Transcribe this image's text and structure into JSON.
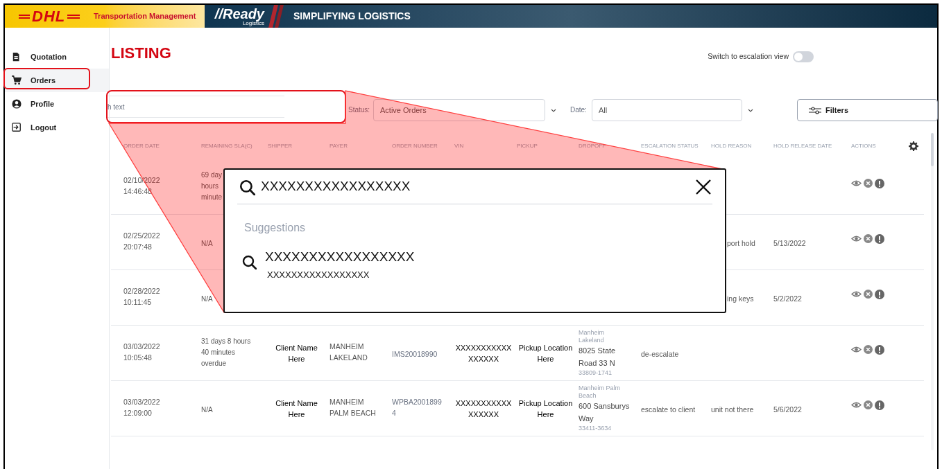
{
  "header": {
    "brand": "DHL",
    "product": "Transportation Management",
    "partner": "//Ready",
    "partner_sub": "Logistics",
    "tagline": "SIMPLIFYING LOGISTICS"
  },
  "sidebar": {
    "items": [
      {
        "kind": "document",
        "label": "Quotation",
        "selected": false,
        "highlighted": false
      },
      {
        "kind": "cart",
        "label": "Orders",
        "selected": true,
        "highlighted": true
      },
      {
        "kind": "account",
        "label": "Profile",
        "selected": false,
        "highlighted": false
      },
      {
        "kind": "logout",
        "label": "Logout",
        "selected": false,
        "highlighted": false
      }
    ]
  },
  "page_title": "LISTING",
  "escalation_toggle": {
    "label": "Switch to escalation view",
    "on": false
  },
  "search": {
    "placeholder": "h text",
    "highlighted": true
  },
  "status_filter": {
    "label": "Status:",
    "value": "Active Orders"
  },
  "date_filter": {
    "label": "Date:",
    "value": "All"
  },
  "filters_button": {
    "label": "Filters"
  },
  "table": {
    "columns": [
      "ORDER DATE",
      "REMAINING SLA(C)",
      "SHIPPER",
      "PAYER",
      "ORDER NUMBER",
      "VIN",
      "PICKUP",
      "DROPOFF",
      "ESCALATION STATUS",
      "HOLD REASON",
      "HOLD RELEASE DATE",
      "ACTIONS"
    ],
    "rows": [
      {
        "order_date": "02/10/2022\n14:46:48",
        "remaining_sla": "69 day\nhours\nminute"
      },
      {
        "order_date": "02/25/2022\n20:07:48",
        "remaining_sla": "N/A",
        "hold_reason": "port hold",
        "hold_release_date": "5/13/2022"
      },
      {
        "order_date": "02/28/2022\n10:11:45",
        "remaining_sla": "N/A",
        "hold_reason": "ing keys",
        "hold_release_date": "5/2/2022"
      },
      {
        "order_date": "03/03/2022\n10:05:48",
        "remaining_sla": "31 days 8 hours\n40 minutes\noverdue",
        "shipper": "Client Name\nHere",
        "payer": "MANHEIM\nLAKELAND",
        "order_number": "IMS20018990",
        "vin": "XXXXXXXXXXX\nXXXXXX",
        "pickup": "Pickup Location\nHere",
        "dropoff": {
          "name": "Manheim\nLakeland",
          "address": "8025 State\nRoad 33 N",
          "zip": "33809-1741"
        },
        "escalation_status": "de-escalate"
      },
      {
        "order_date": "03/03/2022\n12:09:00",
        "remaining_sla": "N/A",
        "shipper": "Client Name\nHere",
        "payer": "MANHEIM\nPALM BEACH",
        "order_number": "WPBA2001899\n4",
        "vin": "XXXXXXXXXXX\nXXXXXX",
        "pickup": "Pickup Location\nHere",
        "dropoff": {
          "name": "Manheim Palm\nBeach",
          "address": "600 Sansburys\nWay",
          "zip": "33411-3634"
        },
        "escalation_status": "escalate to client",
        "hold_reason": "unit not there",
        "hold_release_date": "5/6/2022"
      }
    ]
  },
  "search_callout": {
    "query": "XXXXXXXXXXXXXXXXX",
    "suggestions_label": "Suggestions",
    "suggestions": [
      {
        "title": "XXXXXXXXXXXXXXXXX",
        "subtitle": "XXXXXXXXXXXXXXXXX"
      }
    ]
  }
}
